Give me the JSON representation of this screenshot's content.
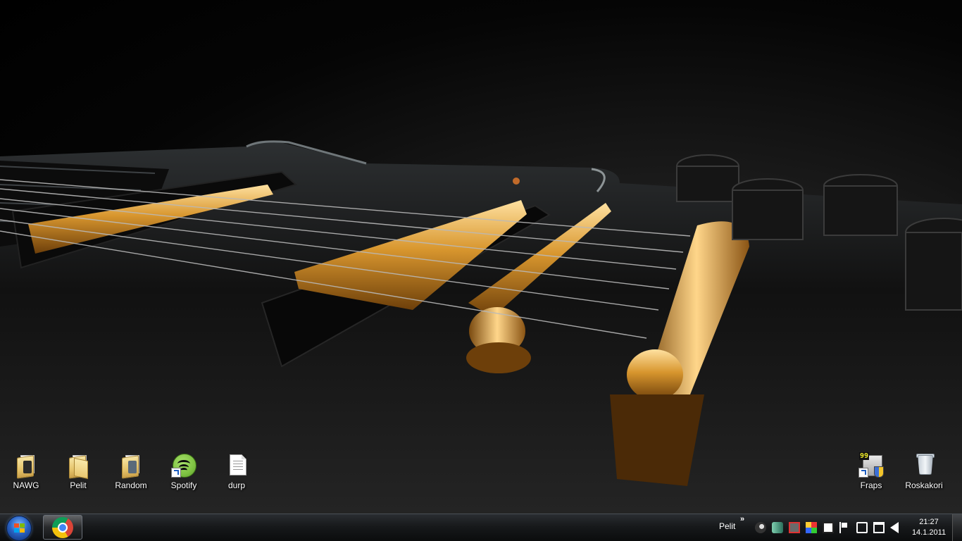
{
  "desktop": {
    "icons_left": [
      {
        "label": "NAWG",
        "icon": "folder-icon"
      },
      {
        "label": "Pelit",
        "icon": "folder-icon"
      },
      {
        "label": "Random",
        "icon": "folder-icon"
      },
      {
        "label": "Spotify",
        "icon": "spotify-icon"
      },
      {
        "label": "durp",
        "icon": "text-document-icon"
      }
    ],
    "icons_right": [
      {
        "label": "Fraps",
        "icon": "fraps-icon",
        "badge": "99"
      },
      {
        "label": "Roskakori",
        "icon": "recycle-bin-icon"
      }
    ]
  },
  "taskbar": {
    "start_icon": "windows-orb-icon",
    "pinned": [
      {
        "name": "chrome",
        "icon": "chrome-icon"
      }
    ],
    "toolbar_label": "Pelit",
    "toolbar_chevron": "»",
    "tray_icons": [
      "steam-icon",
      "app-icon",
      "network-blocked-icon",
      "colorful-app-icon",
      "monitor-icon",
      "task-icon",
      "action-center-flag-icon",
      "usb-icon",
      "network-icon",
      "volume-icon"
    ],
    "clock": {
      "time": "21:27",
      "date": "14.1.2011"
    }
  },
  "colors": {
    "taskbar": "#17191b",
    "gold": "#c98a2a",
    "body": "#0b0b0b"
  }
}
